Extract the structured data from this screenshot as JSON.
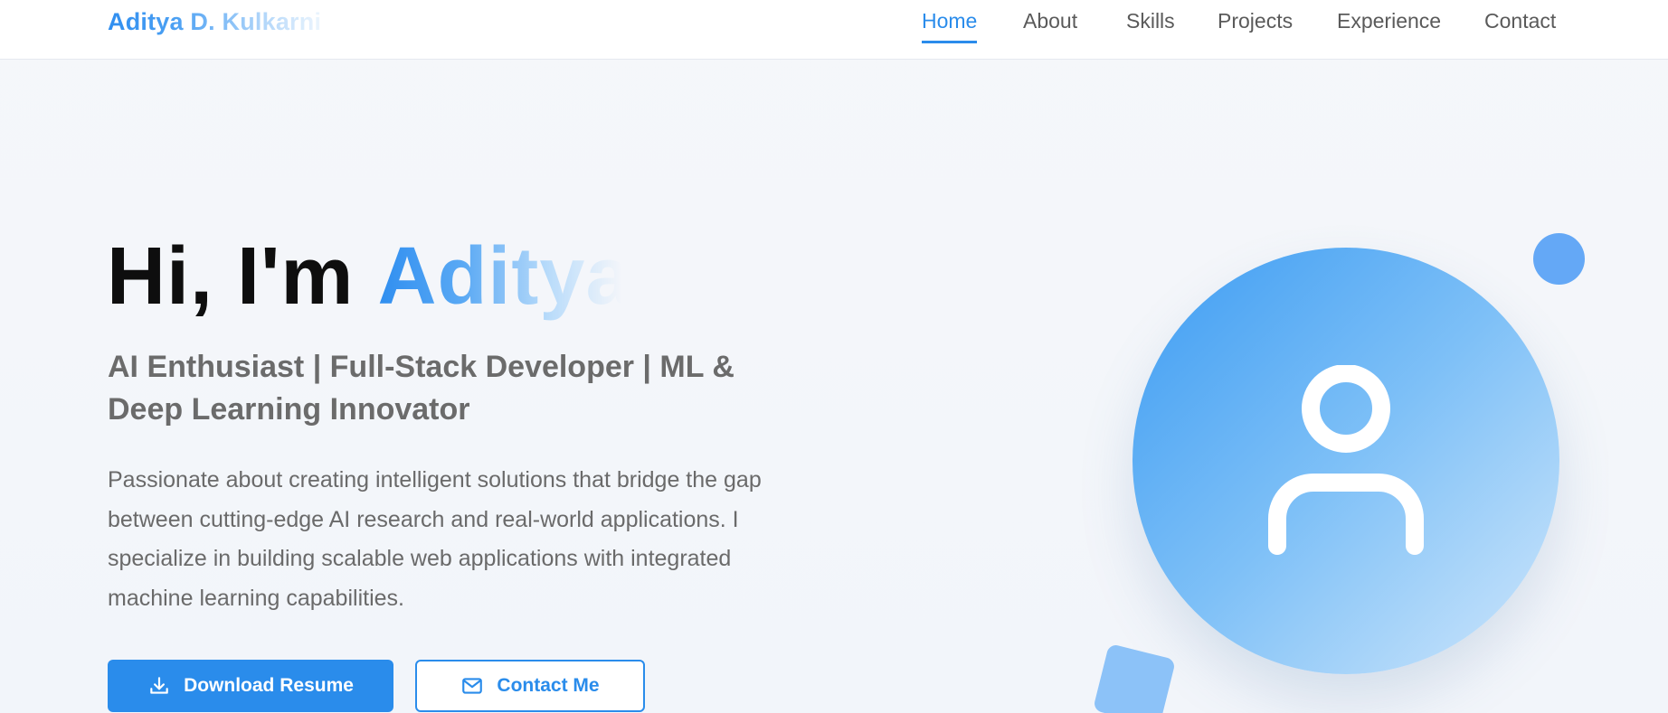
{
  "header": {
    "brand": "Aditya D. Kulkarni",
    "nav": [
      {
        "label": "Home",
        "active": true
      },
      {
        "label": "About",
        "active": false
      },
      {
        "label": "Skills",
        "active": false
      },
      {
        "label": "Projects",
        "active": false
      },
      {
        "label": "Experience",
        "active": false
      },
      {
        "label": "Contact",
        "active": false
      }
    ]
  },
  "hero": {
    "greeting": "Hi, I'm ",
    "name": "Aditya",
    "subtitle": "AI Enthusiast | Full-Stack Developer | ML & Deep Learning Innovator",
    "description": "Passionate about creating intelligent solutions that bridge the gap between cutting-edge AI research and real-world applications. I specialize in building scalable web applications with integrated machine learning capabilities.",
    "buttons": {
      "download": {
        "label": "Download Resume",
        "icon": "download-icon"
      },
      "contact": {
        "label": "Contact Me",
        "icon": "mail-icon"
      }
    },
    "avatar_icon": "user-icon"
  },
  "colors": {
    "accent": "#2a8ceb",
    "background": "#f4f6fa",
    "text_muted": "#6b6b6b"
  }
}
